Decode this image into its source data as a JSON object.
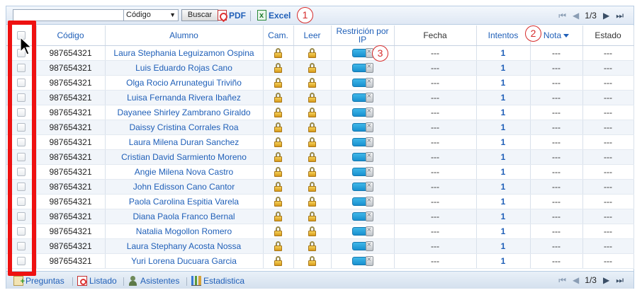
{
  "toolbar": {
    "search_value": "",
    "select_value": "Código",
    "search_label": "Buscar",
    "pdf_label": "PDF",
    "excel_label": "Excel",
    "pager_text": "1/3"
  },
  "annotations": {
    "one": "1",
    "two": "2",
    "three": "3"
  },
  "columns": {
    "codigo": "Código",
    "alumno": "Alumno",
    "cam": "Cam.",
    "leer": "Leer",
    "restriccion": "Restrición por IP",
    "fecha": "Fecha",
    "intentos": "Intentos",
    "nota": "Nota",
    "estado": "Estado"
  },
  "rows": [
    {
      "codigo": "987654321",
      "alumno": "Laura Stephania Leguizamon Ospina",
      "fecha": "---",
      "intentos": "1",
      "nota": "---",
      "estado": "---"
    },
    {
      "codigo": "987654321",
      "alumno": "Luis Eduardo Rojas Cano",
      "fecha": "---",
      "intentos": "1",
      "nota": "---",
      "estado": "---"
    },
    {
      "codigo": "987654321",
      "alumno": "Olga Rocio Arrunategui Triviño",
      "fecha": "---",
      "intentos": "1",
      "nota": "---",
      "estado": "---"
    },
    {
      "codigo": "987654321",
      "alumno": "Luisa Fernanda Rivera Ibañez",
      "fecha": "---",
      "intentos": "1",
      "nota": "---",
      "estado": "---"
    },
    {
      "codigo": "987654321",
      "alumno": "Dayanee Shirley Zambrano Giraldo",
      "fecha": "---",
      "intentos": "1",
      "nota": "---",
      "estado": "---"
    },
    {
      "codigo": "987654321",
      "alumno": "Daissy Cristina Corrales Roa",
      "fecha": "---",
      "intentos": "1",
      "nota": "---",
      "estado": "---"
    },
    {
      "codigo": "987654321",
      "alumno": "Laura Milena Duran Sanchez",
      "fecha": "---",
      "intentos": "1",
      "nota": "---",
      "estado": "---"
    },
    {
      "codigo": "987654321",
      "alumno": "Cristian David Sarmiento Moreno",
      "fecha": "---",
      "intentos": "1",
      "nota": "---",
      "estado": "---"
    },
    {
      "codigo": "987654321",
      "alumno": "Angie Milena Nova Castro",
      "fecha": "---",
      "intentos": "1",
      "nota": "---",
      "estado": "---"
    },
    {
      "codigo": "987654321",
      "alumno": "John Edisson Cano Cantor",
      "fecha": "---",
      "intentos": "1",
      "nota": "---",
      "estado": "---"
    },
    {
      "codigo": "987654321",
      "alumno": "Paola Carolina Espitia Varela",
      "fecha": "---",
      "intentos": "1",
      "nota": "---",
      "estado": "---"
    },
    {
      "codigo": "987654321",
      "alumno": "Diana Paola Franco Bernal",
      "fecha": "---",
      "intentos": "1",
      "nota": "---",
      "estado": "---"
    },
    {
      "codigo": "987654321",
      "alumno": "Natalia Mogollon Romero",
      "fecha": "---",
      "intentos": "1",
      "nota": "---",
      "estado": "---"
    },
    {
      "codigo": "987654321",
      "alumno": "Laura Stephany Acosta Nossa",
      "fecha": "---",
      "intentos": "1",
      "nota": "---",
      "estado": "---"
    },
    {
      "codigo": "987654321",
      "alumno": "Yuri Lorena Ducuara Garcia",
      "fecha": "---",
      "intentos": "1",
      "nota": "---",
      "estado": "---"
    }
  ],
  "footer": {
    "preguntas": "Preguntas",
    "listado": "Listado",
    "asistentes": "Asistentes",
    "estadistica": "Estadistica",
    "pager_text": "1/3"
  },
  "icons": {
    "pdf": "pdf-icon",
    "excel": "excel-icon",
    "lock": "lock-icon",
    "toggle": "ip-restriction-toggle",
    "cursor": "mouse-cursor-icon",
    "first": "first-page-icon",
    "prev": "prev-page-icon",
    "next": "next-page-icon",
    "last": "last-page-icon"
  },
  "colors": {
    "link": "#1f5fb8",
    "highlight": "#ee1111",
    "annotation": "#d62b2b",
    "toggle_on": "#1990cf"
  }
}
